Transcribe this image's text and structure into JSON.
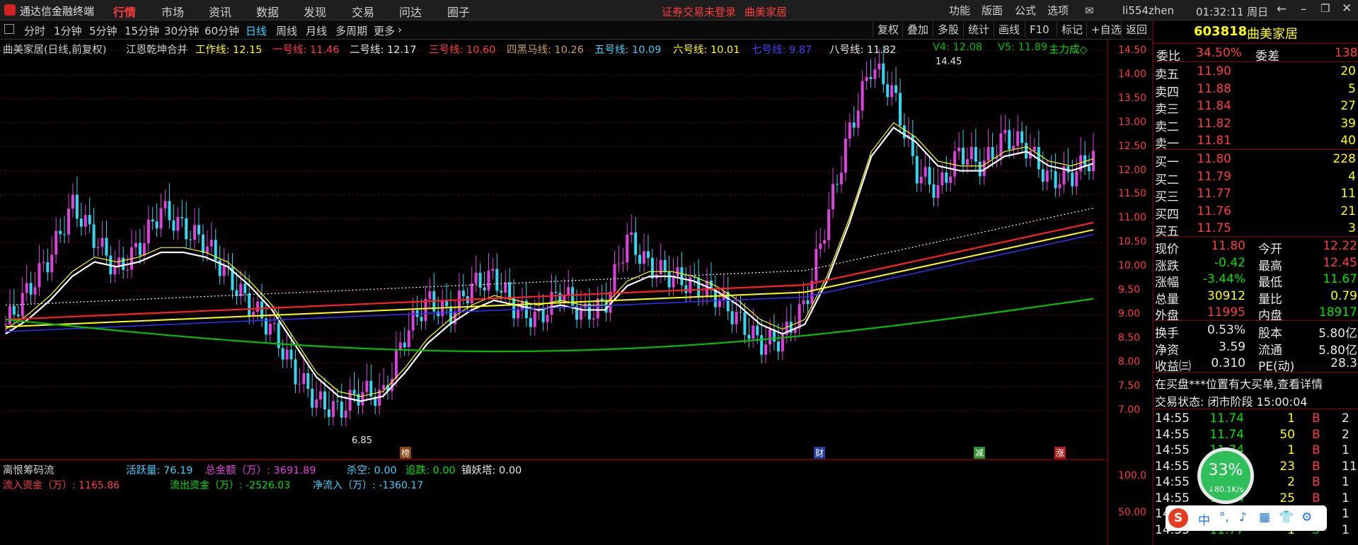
{
  "app_title": "通达信金融终端",
  "menu": [
    "行情",
    "市场",
    "资讯",
    "数据",
    "发现",
    "交易",
    "问达",
    "圈子"
  ],
  "notice": "证券交易未登录",
  "stock_name_top": "曲美家居",
  "right_menu": [
    "功能",
    "版面",
    "公式",
    "选项"
  ],
  "user": "li554zhen",
  "clock": "01:32:11 周日",
  "periods": [
    "分时",
    "1分钟",
    "5分钟",
    "15分钟",
    "30分钟",
    "60分钟",
    "日线",
    "周线",
    "月线",
    "多周期",
    "更多"
  ],
  "period_active": "日线",
  "toolbar_right": [
    "复权",
    "叠加",
    "多股",
    "统计",
    "画线",
    "F10",
    "标记",
    "+自选",
    "返回"
  ],
  "indicator": {
    "title": "曲美家居(日线,前复权)",
    "formula": "江恩乾坤合并",
    "work": "工作线: 12.15",
    "l1": "一号线: 11.46",
    "l2": "二号线: 12.17",
    "l3": "三号线: 10.60",
    "l4": "四黑马线: 10.26",
    "l5": "五号线: 10.09",
    "l6": "六号线: 10.01",
    "l7": "七号线: 9.87",
    "l8": "八号线: 11.82",
    "v4": "V4: 12.08",
    "v5": "V5: 11.89",
    "main": "主力成◇"
  },
  "chart_marks": {
    "high": "14.45",
    "low": "6.85",
    "tags": [
      "榜",
      "财",
      "减",
      "涨"
    ]
  },
  "chart_data": {
    "type": "line",
    "title": "曲美家居(日线,前复权)",
    "ylim": [
      6.5,
      14.6
    ],
    "y_ticks": [
      "14.50",
      "14.00",
      "13.50",
      "13.00",
      "12.50",
      "12.00",
      "11.50",
      "11.00",
      "10.50",
      "10.00",
      "9.50",
      "9.00",
      "8.50",
      "8.00",
      "7.50",
      "7.00"
    ],
    "sub_y_ticks": [
      "100.0",
      "50.00"
    ],
    "series": [
      {
        "name": "close",
        "values": [
          8.8,
          9.5,
          10.2,
          11.3,
          10.6,
          9.9,
          10.4,
          11.2,
          10.8,
          10.5,
          9.8,
          9.2,
          8.7,
          7.8,
          7.2,
          7.0,
          7.4,
          7.3,
          8.6,
          9.3,
          9.0,
          9.6,
          9.8,
          9.1,
          8.9,
          9.5,
          9.0,
          9.2,
          10.6,
          10.0,
          9.8,
          9.6,
          9.4,
          8.9,
          8.4,
          8.5,
          9.2,
          11.0,
          12.8,
          14.2,
          13.6,
          12.0,
          11.6,
          12.4,
          12.1,
          12.7,
          12.5,
          11.8,
          11.9,
          12.3
        ]
      },
      {
        "name": "work",
        "values": [
          8.6,
          8.9,
          9.3,
          9.8,
          10.1,
          10.0,
          10.1,
          10.3,
          10.3,
          10.2,
          10.0,
          9.6,
          9.1,
          8.4,
          7.7,
          7.3,
          7.2,
          7.3,
          7.8,
          8.4,
          8.8,
          9.1,
          9.3,
          9.2,
          9.1,
          9.2,
          9.1,
          9.1,
          9.6,
          9.8,
          9.8,
          9.7,
          9.5,
          9.2,
          8.8,
          8.6,
          8.8,
          9.7,
          10.9,
          12.3,
          12.9,
          12.6,
          12.1,
          12.0,
          12.0,
          12.3,
          12.4,
          12.1,
          12.0,
          12.15
        ]
      }
    ]
  },
  "sub": {
    "name": "离恨筹码流",
    "active": "活跃量: 76.19",
    "amount": "总金额（万）: 3691.89",
    "kill": "杀空: 0.00",
    "chase": "追跌: 0.00",
    "tower": "镇妖塔: 0.00",
    "inflow": "流入资金（万）: 1165.86",
    "outflow": "流出资金（万）: -2526.03",
    "net": "净流入（万）: -1360.17"
  },
  "quote": {
    "code": "603818",
    "name": "曲美家居",
    "wei_bi_label": "委比",
    "wei_bi": "34.50%",
    "wei_cha_label": "委差",
    "wei_cha": "138",
    "asks": [
      [
        "卖五",
        "11.90",
        "20"
      ],
      [
        "卖四",
        "11.88",
        "5"
      ],
      [
        "卖三",
        "11.84",
        "27"
      ],
      [
        "卖二",
        "11.82",
        "39"
      ],
      [
        "卖一",
        "11.81",
        "40"
      ]
    ],
    "bids": [
      [
        "买一",
        "11.80",
        "228"
      ],
      [
        "买二",
        "11.79",
        "4"
      ],
      [
        "买三",
        "11.77",
        "11"
      ],
      [
        "买四",
        "11.76",
        "21"
      ],
      [
        "买五",
        "11.75",
        "3"
      ]
    ],
    "stats": [
      [
        "现价",
        "11.80",
        "今开",
        "12.22"
      ],
      [
        "涨跌",
        "-0.42",
        "最高",
        "12.45"
      ],
      [
        "涨幅",
        "-3.44%",
        "最低",
        "11.67"
      ],
      [
        "总量",
        "30912",
        "量比",
        "0.79"
      ],
      [
        "外盘",
        "11995",
        "内盘",
        "18917"
      ]
    ],
    "stats2": [
      [
        "换手",
        "0.53%",
        "股本",
        "5.80亿"
      ],
      [
        "净资",
        "3.59",
        "流通",
        "5.80亿"
      ],
      [
        "收益㈢",
        "0.310",
        "PE(动)",
        "28.3"
      ]
    ],
    "notice": "在买盘***位置有大买单,查看详情",
    "trade_state": "交易状态: 闭市阶段 15:00:04",
    "ticks": [
      [
        "14:55",
        "11.74",
        "1",
        "B",
        "2"
      ],
      [
        "14:55",
        "11.74",
        "50",
        "B",
        "2"
      ],
      [
        "14:55",
        "11.74",
        "1",
        "B",
        "1"
      ],
      [
        "14:55",
        "11.74",
        "23",
        "B",
        "11"
      ],
      [
        "14:55",
        "11.74",
        "2",
        "B",
        "1"
      ],
      [
        "14:55",
        "11.74",
        "25",
        "B",
        "1"
      ],
      [
        "14:55",
        "11.77",
        "1",
        "B",
        "1"
      ],
      [
        "14:55",
        "11.77",
        "1",
        "S",
        "1"
      ]
    ]
  },
  "gauge": {
    "pct": "33%",
    "speed": "↓80.1K/s"
  },
  "ime": [
    "中",
    "°,",
    "♪",
    "▦",
    "👕",
    "⚙"
  ]
}
